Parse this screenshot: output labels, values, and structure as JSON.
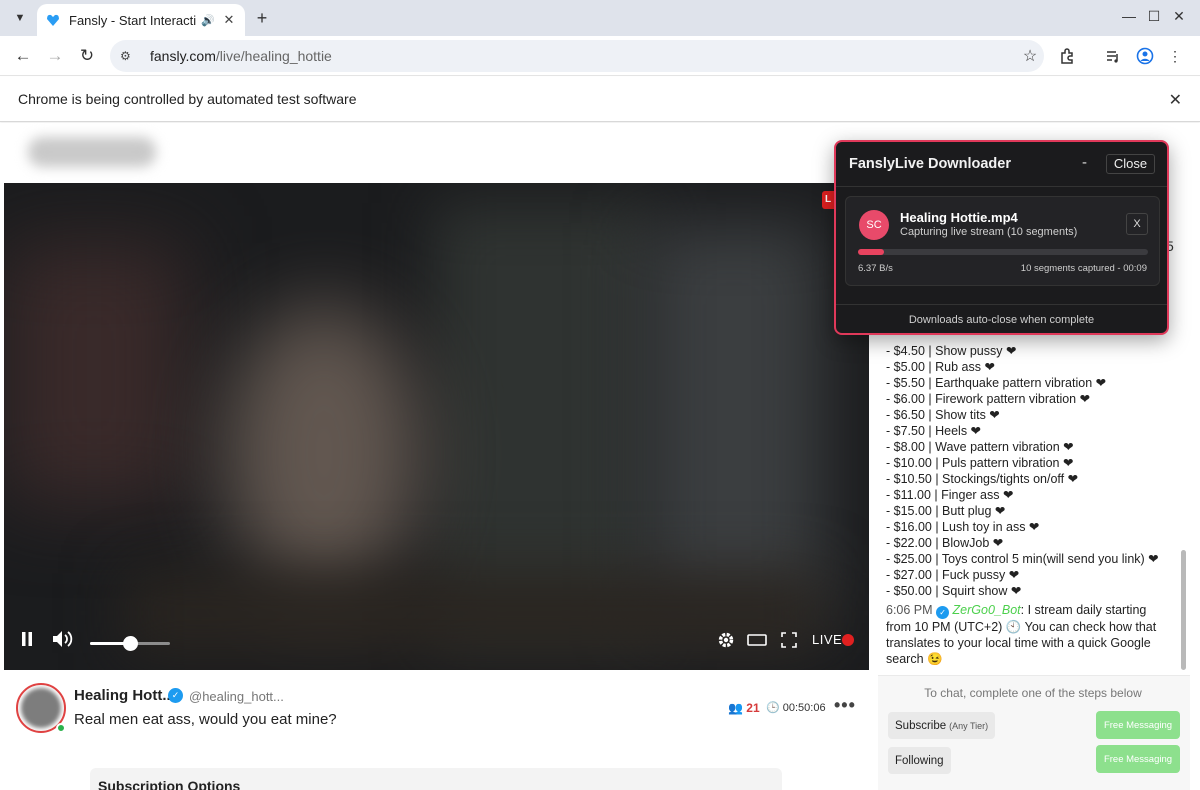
{
  "browser": {
    "tab_title": "Fansly - Start Interacti",
    "url_domain": "fansly.com",
    "url_path": "/live/healing_hottie",
    "infobar_text": "Chrome is being controlled by automated test software"
  },
  "player": {
    "live_label": "LIVE",
    "live_corner": "L",
    "volume_fraction": 0.5
  },
  "streamer": {
    "name": "Healing Hott...",
    "handle": "@healing_hott...",
    "stream_title": "Real men eat ass, would you eat mine?",
    "viewers": "21",
    "uptime": "00:50:06",
    "subscription_heading": "Subscription Options"
  },
  "chat": {
    "partial_number": "5",
    "menu_items": [
      "- $4.50  |  Show pussy ❤",
      "- $5.00  |  Rub ass ❤",
      "- $5.50  |  Earthquake pattern vibration ❤",
      "- $6.00  |  Firework pattern vibration ❤",
      "- $6.50  |  Show tits ❤",
      "- $7.50  |  Heels ❤",
      "- $8.00  |  Wave pattern vibration ❤",
      "- $10.00  |  Puls pattern vibration ❤",
      "- $10.50  |  Stockings/tights on/off ❤",
      "- $11.00  |  Finger ass ❤",
      "- $15.00  |  Butt plug ❤",
      "- $16.00  |  Lush toy in ass ❤",
      "- $22.00  |  BlowJob ❤",
      "- $25.00  |  Toys control 5 min(will send you link) ❤",
      "- $27.00  |  Fuck pussy ❤",
      "- $50.00  |  Squirt show ❤"
    ],
    "message": {
      "time": "6:06 PM",
      "user": "ZerGo0_Bot",
      "text": ": I stream daily starting from 10 PM (UTC+2) 🕙 You can check how that translates to your local time with a quick Google search 😉"
    },
    "footer_hint": "To chat, complete one of the steps below",
    "subscribe_label": "Subscribe",
    "subscribe_note": "(Any Tier)",
    "following_label": "Following",
    "free_messaging_1": "Free Messaging",
    "free_messaging_2": "Free Messaging"
  },
  "downloader": {
    "title": "FanslyLive Downloader",
    "minimize_label": "-",
    "close_label": "Close",
    "avatar_initials": "SC",
    "file_name": "Healing Hottie.mp4",
    "status": "Capturing live stream (10 segments)",
    "progress_fraction": 0.09,
    "speed": "6.37 B/s",
    "segments": "10 segments captured - 00:09",
    "remove_label": "X",
    "footer": "Downloads auto-close when complete",
    "accent_color": "#e8435f"
  }
}
